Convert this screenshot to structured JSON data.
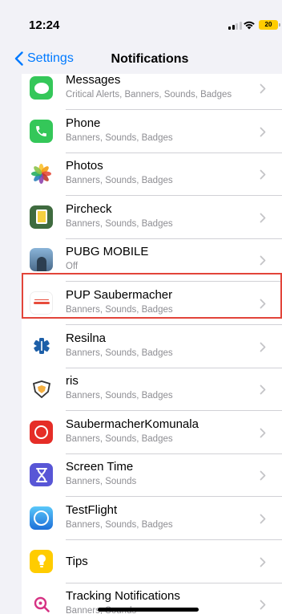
{
  "status_bar": {
    "time": "12:24",
    "battery": "20"
  },
  "nav": {
    "back_label": "Settings",
    "title": "Notifications"
  },
  "colors": {
    "accent": "#007aff",
    "highlight": "#e2453a"
  },
  "apps": [
    {
      "name": "Messages",
      "subtitle": "Critical Alerts, Banners, Sounds, Badges",
      "icon": "messages-icon"
    },
    {
      "name": "Phone",
      "subtitle": "Banners, Sounds, Badges",
      "icon": "phone-icon"
    },
    {
      "name": "Photos",
      "subtitle": "Banners, Sounds, Badges",
      "icon": "photos-icon"
    },
    {
      "name": "Pircheck",
      "subtitle": "Banners, Sounds, Badges",
      "icon": "pircheck-icon"
    },
    {
      "name": "PUBG MOBILE",
      "subtitle": "Off",
      "icon": "pubg-icon"
    },
    {
      "name": "PUP Saubermacher",
      "subtitle": "Banners, Sounds, Badges",
      "icon": "pup-saubermacher-icon",
      "highlighted": true
    },
    {
      "name": "Resilna",
      "subtitle": "Banners, Sounds, Badges",
      "icon": "resilna-icon"
    },
    {
      "name": "ris",
      "subtitle": "Banners, Sounds, Badges",
      "icon": "ris-icon"
    },
    {
      "name": "SaubermacherKomunala",
      "subtitle": "Banners, Sounds, Badges",
      "icon": "saubermacher-komunala-icon"
    },
    {
      "name": "Screen Time",
      "subtitle": "Banners, Sounds",
      "icon": "hourglass-icon"
    },
    {
      "name": "TestFlight",
      "subtitle": "Banners, Sounds, Badges",
      "icon": "testflight-icon"
    },
    {
      "name": "Tips",
      "subtitle": "",
      "icon": "lightbulb-icon"
    },
    {
      "name": "Tracking Notifications",
      "subtitle": "Banners, Sounds",
      "icon": "tracking-icon"
    }
  ]
}
